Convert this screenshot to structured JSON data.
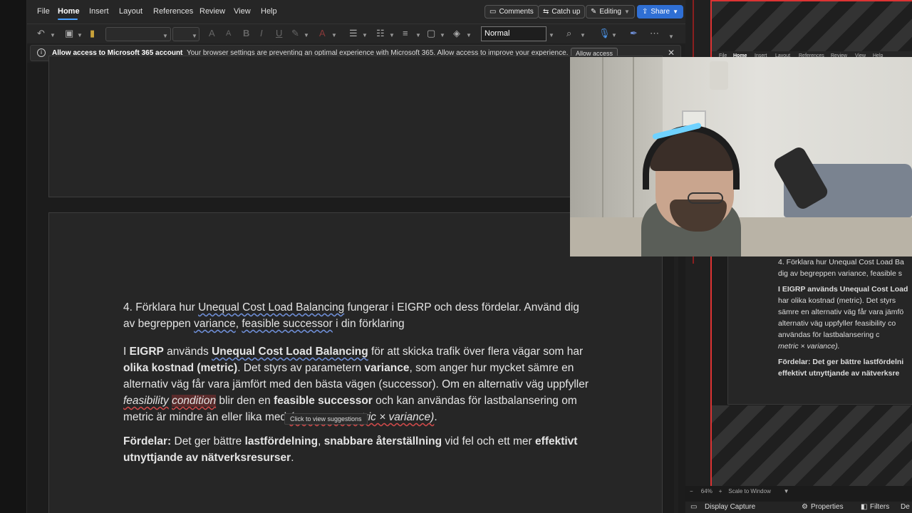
{
  "menu": {
    "file": "File",
    "home": "Home",
    "insert": "Insert",
    "layout": "Layout",
    "references": "References",
    "review": "Review",
    "view": "View",
    "help": "Help"
  },
  "topbar": {
    "comments": "Comments",
    "catchup": "Catch up",
    "editing": "Editing",
    "share": "Share"
  },
  "ribbon": {
    "style_value": "Normal"
  },
  "notice": {
    "title": "Allow access to Microsoft 365 account",
    "message": "Your browser settings are preventing an optimal experience with Microsoft 365. Allow access to improve your experience.",
    "button": "Allow access"
  },
  "document": {
    "question": {
      "p1": "4. Förklara hur ",
      "t1": "Unequal Cost Load Balancing",
      "p2": " fungerar i EIGRP och dess fördelar. Använd dig av begreppen ",
      "t2": "variance",
      "p3": ", ",
      "t3": "feasible successor",
      "p4": " i din förklaring"
    },
    "answer": {
      "a1": "I ",
      "b1": "EIGRP",
      "a2": " används ",
      "b2": "Unequal Cost Load Balancing",
      "a3": " för att skicka trafik över flera vägar som har ",
      "b3": "olika kostnad (metric)",
      "a4": ". Det styrs av parametern ",
      "b4": "variance",
      "a5": ", som anger hur mycket sämre en alternativ väg får vara jämfört med den bästa vägen (successor). Om en alternativ väg uppfyller ",
      "i1": "feasibility",
      "a6": " ",
      "i2": "condition",
      "a7": " blir den en ",
      "b5": "feasible successor",
      "a8": " och kan användas för lastbalansering om metric är mindre än eller lika med ",
      "i3": "(successor metric × variance)",
      "a9": "."
    },
    "advantages": {
      "label": "Fördelar:",
      "a1": " Det ger bättre ",
      "b1": "lastfördelning",
      "a2": ", ",
      "b2": "snabbare återställning",
      "a3": " vid fel och ett mer ",
      "b3": "effektivt utnyttjande av nätverksresurser",
      "a4": "."
    },
    "tooltip": "Click to view suggestions"
  },
  "obs": {
    "mini_menu": [
      "File",
      "Home",
      "Insert",
      "Layout",
      "References",
      "Review",
      "View",
      "Help"
    ],
    "mini_q1": "4. Förklara hur Unequal Cost Load Ba",
    "mini_q2": "dig av begreppen variance, feasible s",
    "mini_a1": "I EIGRP används Unequal Cost Load",
    "mini_a2": "har olika kostnad (metric). Det styrs",
    "mini_a3": "sämre en alternativ väg får vara jämfö",
    "mini_a4": "alternativ väg uppfyller feasibility co",
    "mini_a5": "användas för lastbalansering c",
    "mini_a6": "metric × variance).",
    "mini_f1": "Fördelar: Det ger bättre lastfördelni",
    "mini_f2": "effektivt utnyttjande av nätverksre",
    "zoom": "64%",
    "scale": "Scale to Window",
    "display_capture": "Display Capture",
    "properties": "Properties",
    "filters": "Filters",
    "de": "De"
  }
}
